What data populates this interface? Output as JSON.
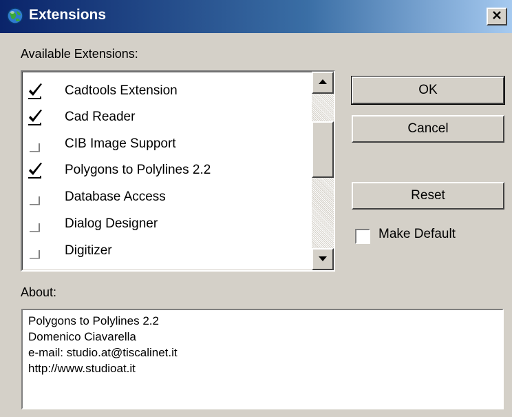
{
  "window": {
    "title": "Extensions",
    "close_label": "X"
  },
  "available_label": "Available Extensions:",
  "extensions": [
    {
      "label": "Cadtools Extension",
      "checked": true
    },
    {
      "label": "Cad Reader",
      "checked": true
    },
    {
      "label": "CIB Image Support",
      "checked": false
    },
    {
      "label": "Polygons to Polylines 2.2",
      "checked": true
    },
    {
      "label": "Database Access",
      "checked": false
    },
    {
      "label": "Dialog Designer",
      "checked": false
    },
    {
      "label": "Digitizer",
      "checked": false
    }
  ],
  "buttons": {
    "ok": "OK",
    "cancel": "Cancel",
    "reset": "Reset"
  },
  "make_default": {
    "label": "Make Default",
    "checked": false
  },
  "about": {
    "label": "About:",
    "lines": [
      "Polygons to Polylines 2.2",
      "Domenico Ciavarella",
      "e-mail: studio.at@tiscalinet.it",
      "http://www.studioat.it"
    ]
  }
}
